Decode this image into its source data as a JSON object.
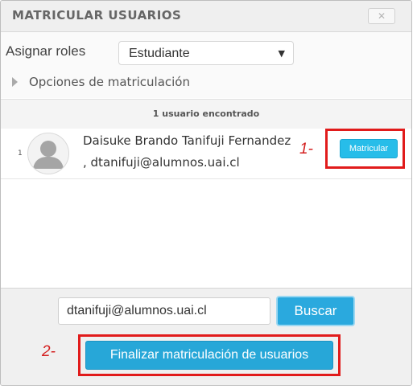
{
  "dialog": {
    "title": "MATRICULAR USUARIOS",
    "close_label": "✕"
  },
  "options": {
    "roles_label": "Asignar roles",
    "roles_selected": "Estudiante",
    "enrol_options_label": "Opciones de matriculación"
  },
  "results": {
    "count_text": "1 usuario encontrado",
    "users": [
      {
        "index": "1",
        "name": "Daisuke Brando Tanifuji Fernandez",
        "email": ", dtanifuji@alumnos.uai.cl",
        "enrol_label": "Matricular"
      }
    ]
  },
  "footer": {
    "search_value": "dtanifuji@alumnos.uai.cl",
    "search_label": "Buscar",
    "finish_label": "Finalizar matriculación de usuarios"
  },
  "annotations": {
    "step1": "1-",
    "step2": "2-"
  },
  "icons": {
    "avatar": "user-avatar-icon",
    "dropdown": "caret-down-icon",
    "expand": "triangle-right-icon",
    "close": "close-icon"
  },
  "colors": {
    "accent": "#27a7d8",
    "annotation": "#e11b1b"
  }
}
